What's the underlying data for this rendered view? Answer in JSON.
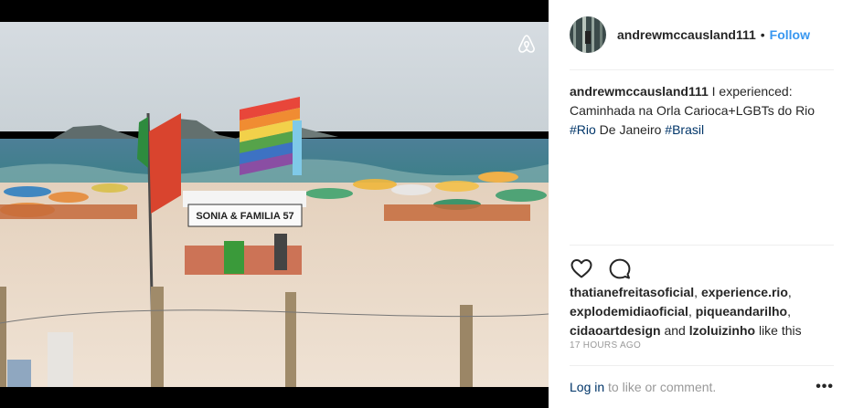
{
  "post": {
    "username": "andrewmccausland111",
    "separator": "•",
    "follow_label": "Follow",
    "caption": {
      "username": "andrewmccausland111",
      "text1": " I experienced: Caminhada na Orla Carioca+LGBTs do Rio ",
      "tag1": "#Rio",
      "text2": " De Janeiro ",
      "tag2": "#Brasil"
    },
    "likes": {
      "user1": "thatianefreitasoficial",
      "sep1": ", ",
      "user2": "experience.rio",
      "sep2": ", ",
      "user3": "explodemidiaoficial",
      "sep3": ", ",
      "user4": "piqueandarilho",
      "sep4": ", ",
      "user5": "cidaoartdesign",
      "and": " and ",
      "user6": "lzoluizinho",
      "suffix": " like this"
    },
    "time": "17 HOURS AGO",
    "footer": {
      "login": "Log in",
      "rest": " to like or comment.",
      "more": "•••"
    },
    "photo_sign": "SONIA & FAMILIA 57",
    "icons": {
      "badge": "airbnb-logo-icon",
      "like": "heart-icon",
      "comment": "comment-icon",
      "more": "more-options-icon"
    }
  }
}
